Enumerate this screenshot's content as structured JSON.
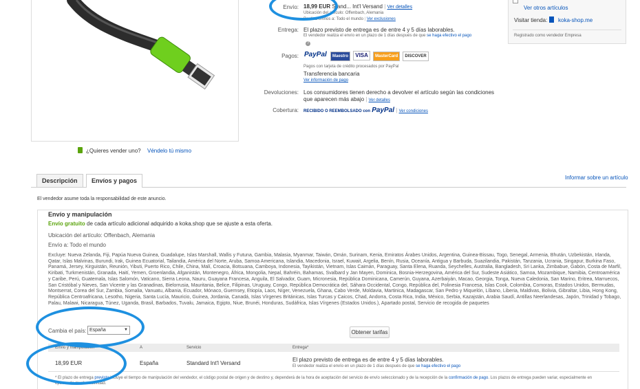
{
  "top": {
    "envio_label": "Envío:",
    "envio_price": "18,99 EUR",
    "envio_service": "Stand... Int'l Versand",
    "envio_details": "Ver detalles",
    "ubicacion": "Ubicación del artículo: Offenbach, Alemania",
    "realiza": "Realiza envíos a: Todo el mundo",
    "ver_exclusiones": "Ver exclusiones",
    "entrega_label": "Entrega:",
    "entrega_text": "El plazo previsto de entrega es de entre 4 y 5 días laborables.",
    "entrega_note": "El vendedor realiza el envío en un plazo de 1 días después de que",
    "entrega_note_link": "se haga efectivo el pago",
    "pagos_label": "Pagos:",
    "paypal_logo": "PayPal",
    "pagos_note": "Pagos con tarjeta de crédito procesados por PayPal",
    "transferencia": "Transferencia bancaria",
    "ver_info_pago": "Ver información de pago",
    "devoluciones_label": "Devoluciones:",
    "devoluciones_text1": "Los consumidores tienen derecho a devolver el artículo según las condiciones",
    "devoluciones_text2": "que aparecen más abajo",
    "ver_detalles": "Ver detalles",
    "cobertura_label": "Cobertura:",
    "cobertura_text": "RECIBIDO O REEMBOLSADO con",
    "ver_condiciones": "Ver condiciones"
  },
  "cards": [
    "Maestro",
    "VISA",
    "MasterCard",
    "DISCOVER"
  ],
  "seller": {
    "ver_otros": "Ver otros artículos",
    "visitar_label": "Visitar tienda:",
    "store_name": "koka-shop.me",
    "registrado": "Registrado como vendedor Empresa"
  },
  "sell": {
    "question": "¿Quieres vender uno?",
    "link": "Véndelo tú mismo"
  },
  "tabs": [
    "Descripción",
    "Envíos y pagos"
  ],
  "informar": "Informar sobre un artículo",
  "responsabilidad": "El vendedor asume toda la responsabilidad de este anuncio.",
  "shipping": {
    "title": "Envío y manipulación",
    "gratuito": "Envío gratuito",
    "gratuito_rest": "de cada artículo adicional adquirido a koka.shop que se ajuste a esta oferta.",
    "ubicacion": "Ubicación del artículo: Offenbach, Alemania",
    "envio_a": "Envío a: Todo el mundo",
    "excluye": "Excluye: Nueva Zelanda, Fiji, Papúa Nueva Guinea, Guadalupe, Islas Marshall, Wallis y Futuna, Gambia, Malasia, Myanmar, Taiwán, Omán, Surinam, Kenia, Emiratos Árabes Unidos, Argentina, Guinea-Bissau, Togo, Senegal, Armenia, Bhután, Uzbekistán, Irlanda, Qatar, Islas Malvinas, Burundi, Irak, Guinea Ecuatorial, Tailandia, América del Norte, Aruba, Samoa Americana, Islandia, Macedonia, Israel, Kuwait, Argelia, Benín, Rusia, Oceanía, Antigua y Barbuda, Suazilandia, Pakistán, Tanzania, Ucrania, Singapur, Burkina Faso, Panamá, Jersey, Kirguistán, Reunión, Yibuti, Puerto Rico, Chile, China, Malí, Croacia, Botsuana, Camboya, Indonesia, Tayikistán, Vietnam, Islas Caimán, Paraguay, Santa Elena, Ruanda, Seychelles, Australia, Bangladesh, Sri Lanka, Zimbabue, Gabón, Costa de Marfil, Kiribati, Turkmenistán, Granada, Haití, Yemen, Groenlandia, Afganistán, Montenegro, África, Mongolia, Nepal, Bahréin, Bahamas, Svalbard y Jan Mayen, Dominica, Bosnia-Herzegovina, América del Sur, Sudeste Asiático, Samoa, Mozambique, Namibia, Centroamérica y Caribe, Perú, Guatemala, Islas Salomón, Vaticano, Sierra Leona, Nauru, Guayana Francesa, Anguila, El Salvador, Guam, Micronesia, República Dominicana, Camerún, Guyana, Azerbaiyán, Macao, Georgia, Tonga, Nueva Caledonia, San Marino, Eritrea, Marruecos, San Cristóbal y Nieves, San Vicente y las Granadinas, Bielorrusia, Mauritania, Belice, Filipinas, Uruguay, Congo, República Democrática del, Sáhara Occidental, Congo, República del, Polinesia Francesa, Islas Cook, Colombia, Comoras, Estados Unidos, Bermudas, Montserrat, Corea del Sur, Zambia, Somalia, Vanuatu, Albania, Ecuador, Mónaco, Guernsey, Etiopía, Laos, Níger, Venezuela, Ghana, Cabo Verde, Moldavia, Martinica, Madagascar, San Pedro y Miquelón, Líbano, Liberia, Maldivas, Bolivia, Gibraltar, Libia, Hong Kong, República Centroafricana, Lesotho, Nigeria, Santa Lucía, Mauricio, Guinea, Jordania, Canadá, Islas Vírgenes Británicas, Islas Turcas y Caicos, Chad, Andorra, Costa Rica, India, México, Serbia, Kazajstán, Arabia Saudí, Antillas Neerlandesas, Japón, Trinidad y Tobago, Palau, Malawi, Nicaragua, Túnez, Uganda, Brasil, Barbados, Tuvalu, Jamaica, Egipto, Niue, Brunéi, Honduras, Sudáfrica, Islas Vírgenes (Estados Unidos.), Apartado postal, Servicio de recogida de paquetes",
    "cambia_label": "Cambia el país:",
    "country_value": "España",
    "obtener": "Obtener tarifas",
    "table_headers": [
      "Envío y manipulación",
      "A",
      "Servicio",
      "Entrega*"
    ],
    "row": {
      "price": "18,99 EUR",
      "dest": "España",
      "service": "Standard Int'l Versand",
      "entrega": "El plazo previsto de entrega es de entre 4 y 5 días laborables.",
      "entrega_note": "El vendedor realiza el envío en un plazo de 1 días después de que",
      "entrega_note_link": "se haga efectivo el pago"
    },
    "footnote_a": "* El plazo de entrega",
    "footnote_link": "previsto",
    "footnote_b": "incluye el tiempo de manipulación del vendedor, el código postal de origen y de destino y, dependerá de la hora de aceptación del servicio de envío seleccionado y de la recepción de la",
    "footnote_link2": "confirmación de pago",
    "footnote_c": ". Los plazos de entrega pueden variar, especialmente en épocas de mucha actividad."
  },
  "colors": {
    "link": "#0654ba",
    "green": "#5ba40d",
    "annotation": "#1e90e0"
  }
}
